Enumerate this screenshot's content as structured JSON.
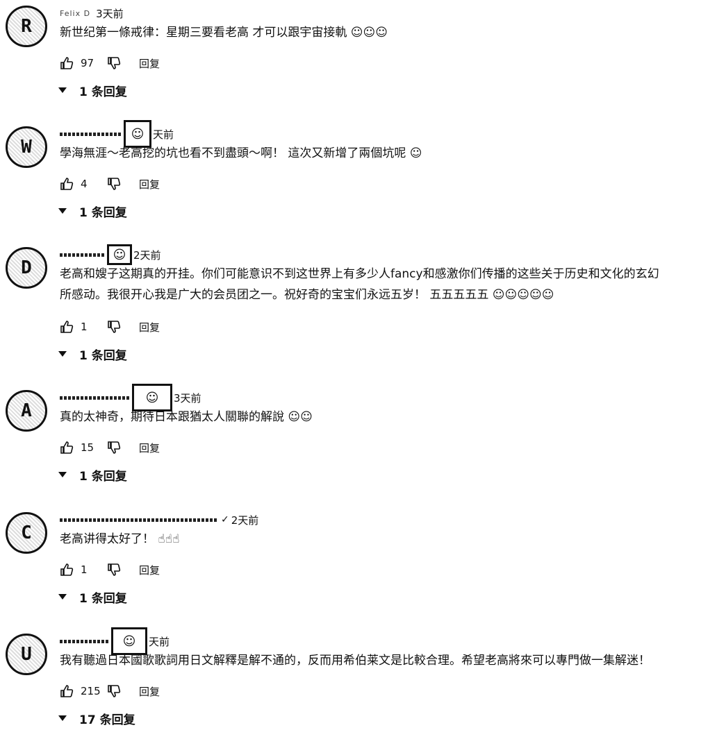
{
  "comments": [
    {
      "author": "Felix D",
      "avatar_glyph": "R",
      "badge": "",
      "time": "3天前",
      "lines": [
        "新世纪第一條戒律：星期三要看老高 才可以跟宇宙接軌 ☺☺☺"
      ],
      "likes": "97",
      "reply_label": "回复",
      "replies_label": "1 条回复"
    },
    {
      "author": "",
      "avatar_glyph": "W",
      "badge": "☺",
      "time": "天前",
      "lines": [
        "學海無涯～老高挖的坑也看不到盡頭～啊！ 這次又新增了兩個坑呢 ☺"
      ],
      "likes": "4",
      "reply_label": "回复",
      "replies_label": "1 条回复"
    },
    {
      "author": "",
      "avatar_glyph": "D",
      "badge": "☺",
      "time": "2天前",
      "lines": [
        "老高和嫂子这期真的开挂。你们可能意识不到这世界上有多少人fancy和感激你们传播的这些关于历史和文化的玄幻",
        "所感动。我很开心我是广大的会员团之一。祝好奇的宝宝们永远五岁！ 五五五五五 ☺☺☺☺☺"
      ],
      "likes": "1",
      "reply_label": "回复",
      "replies_label": "1 条回复"
    },
    {
      "author": "",
      "avatar_glyph": "A",
      "badge": "☺",
      "time": "3天前",
      "lines": [
        "真的太神奇，期待日本跟猶太人關聯的解說 ☺☺"
      ],
      "likes": "15",
      "reply_label": "回复",
      "replies_label": "1 条回复"
    },
    {
      "author": "",
      "avatar_glyph": "C",
      "badge": "",
      "time": "2天前",
      "lines": [
        "老高讲得太好了！ ☝☝☝"
      ],
      "likes": "1",
      "reply_label": "回复",
      "replies_label": "1 条回复"
    },
    {
      "author": "",
      "avatar_glyph": "U",
      "badge": "☺",
      "time": "天前",
      "lines": [
        "我有聽過日本國歌歌詞用日文解釋是解不通的，反而用希伯莱文是比較合理。希望老高將來可以專門做一集解迷！"
      ],
      "likes": "215",
      "reply_label": "回复",
      "replies_label": "17 条回复"
    }
  ]
}
